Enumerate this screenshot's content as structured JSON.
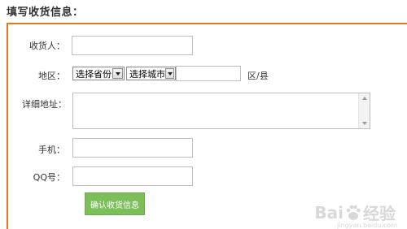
{
  "page": {
    "title": "填写收货信息："
  },
  "form": {
    "receiver": {
      "label": "收货人：",
      "value": ""
    },
    "region": {
      "label": "地区：",
      "province_select": "选择省份",
      "city_select": "选择城市",
      "district_value": "",
      "district_label": "区/县"
    },
    "address": {
      "label": "详细地址：",
      "value": ""
    },
    "phone": {
      "label": "手机：",
      "value": ""
    },
    "qq": {
      "label": "QQ号：",
      "value": ""
    },
    "submit_label": "确认收货信息"
  },
  "watermark": {
    "brand_left": "Bai",
    "brand_right": "经验",
    "url": "jingyan.baidu.com"
  },
  "colors": {
    "frame_border": "#e07a1f",
    "submit_bg": "#7cbf5a"
  }
}
